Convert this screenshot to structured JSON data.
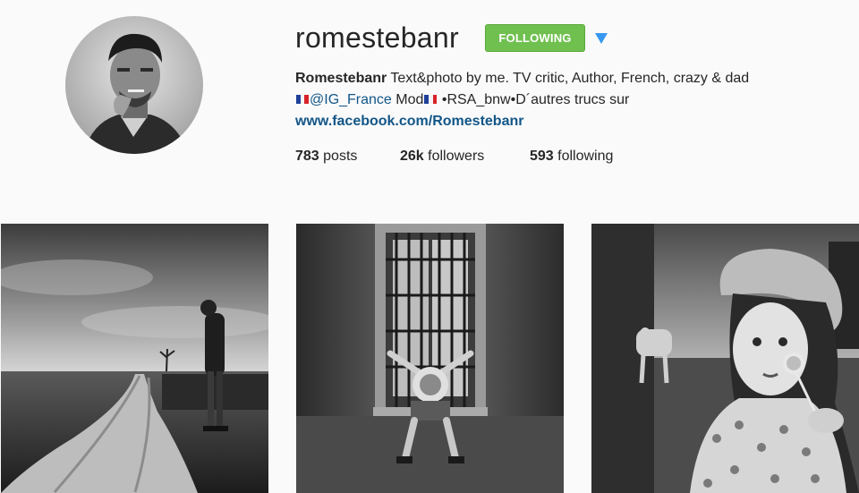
{
  "profile": {
    "username": "romestebanr",
    "follow_button_label": "FOLLOWING",
    "dropdown_icon": "caret-down-icon",
    "accent_color": "#70c050",
    "link_color": "#125688"
  },
  "bio": {
    "name": "Romestebanr",
    "line1": " Text&photo by me. TV critic, Author, French, crazy & dad",
    "tag": "@IG_France",
    "mod": " Mod",
    "line2_rest": " •RSA_bnw•D´autres trucs sur",
    "website": "www.facebook.com/Romestebanr"
  },
  "stats": {
    "posts_count": "783",
    "posts_label": " posts",
    "followers_count": "26k",
    "followers_label": " followers",
    "following_count": "593",
    "following_label": " following"
  },
  "photos": [
    {
      "description": "man-on-dirt-road-photo"
    },
    {
      "description": "boy-on-window-bars-photo"
    },
    {
      "description": "girl-with-lollipop-photo"
    }
  ]
}
